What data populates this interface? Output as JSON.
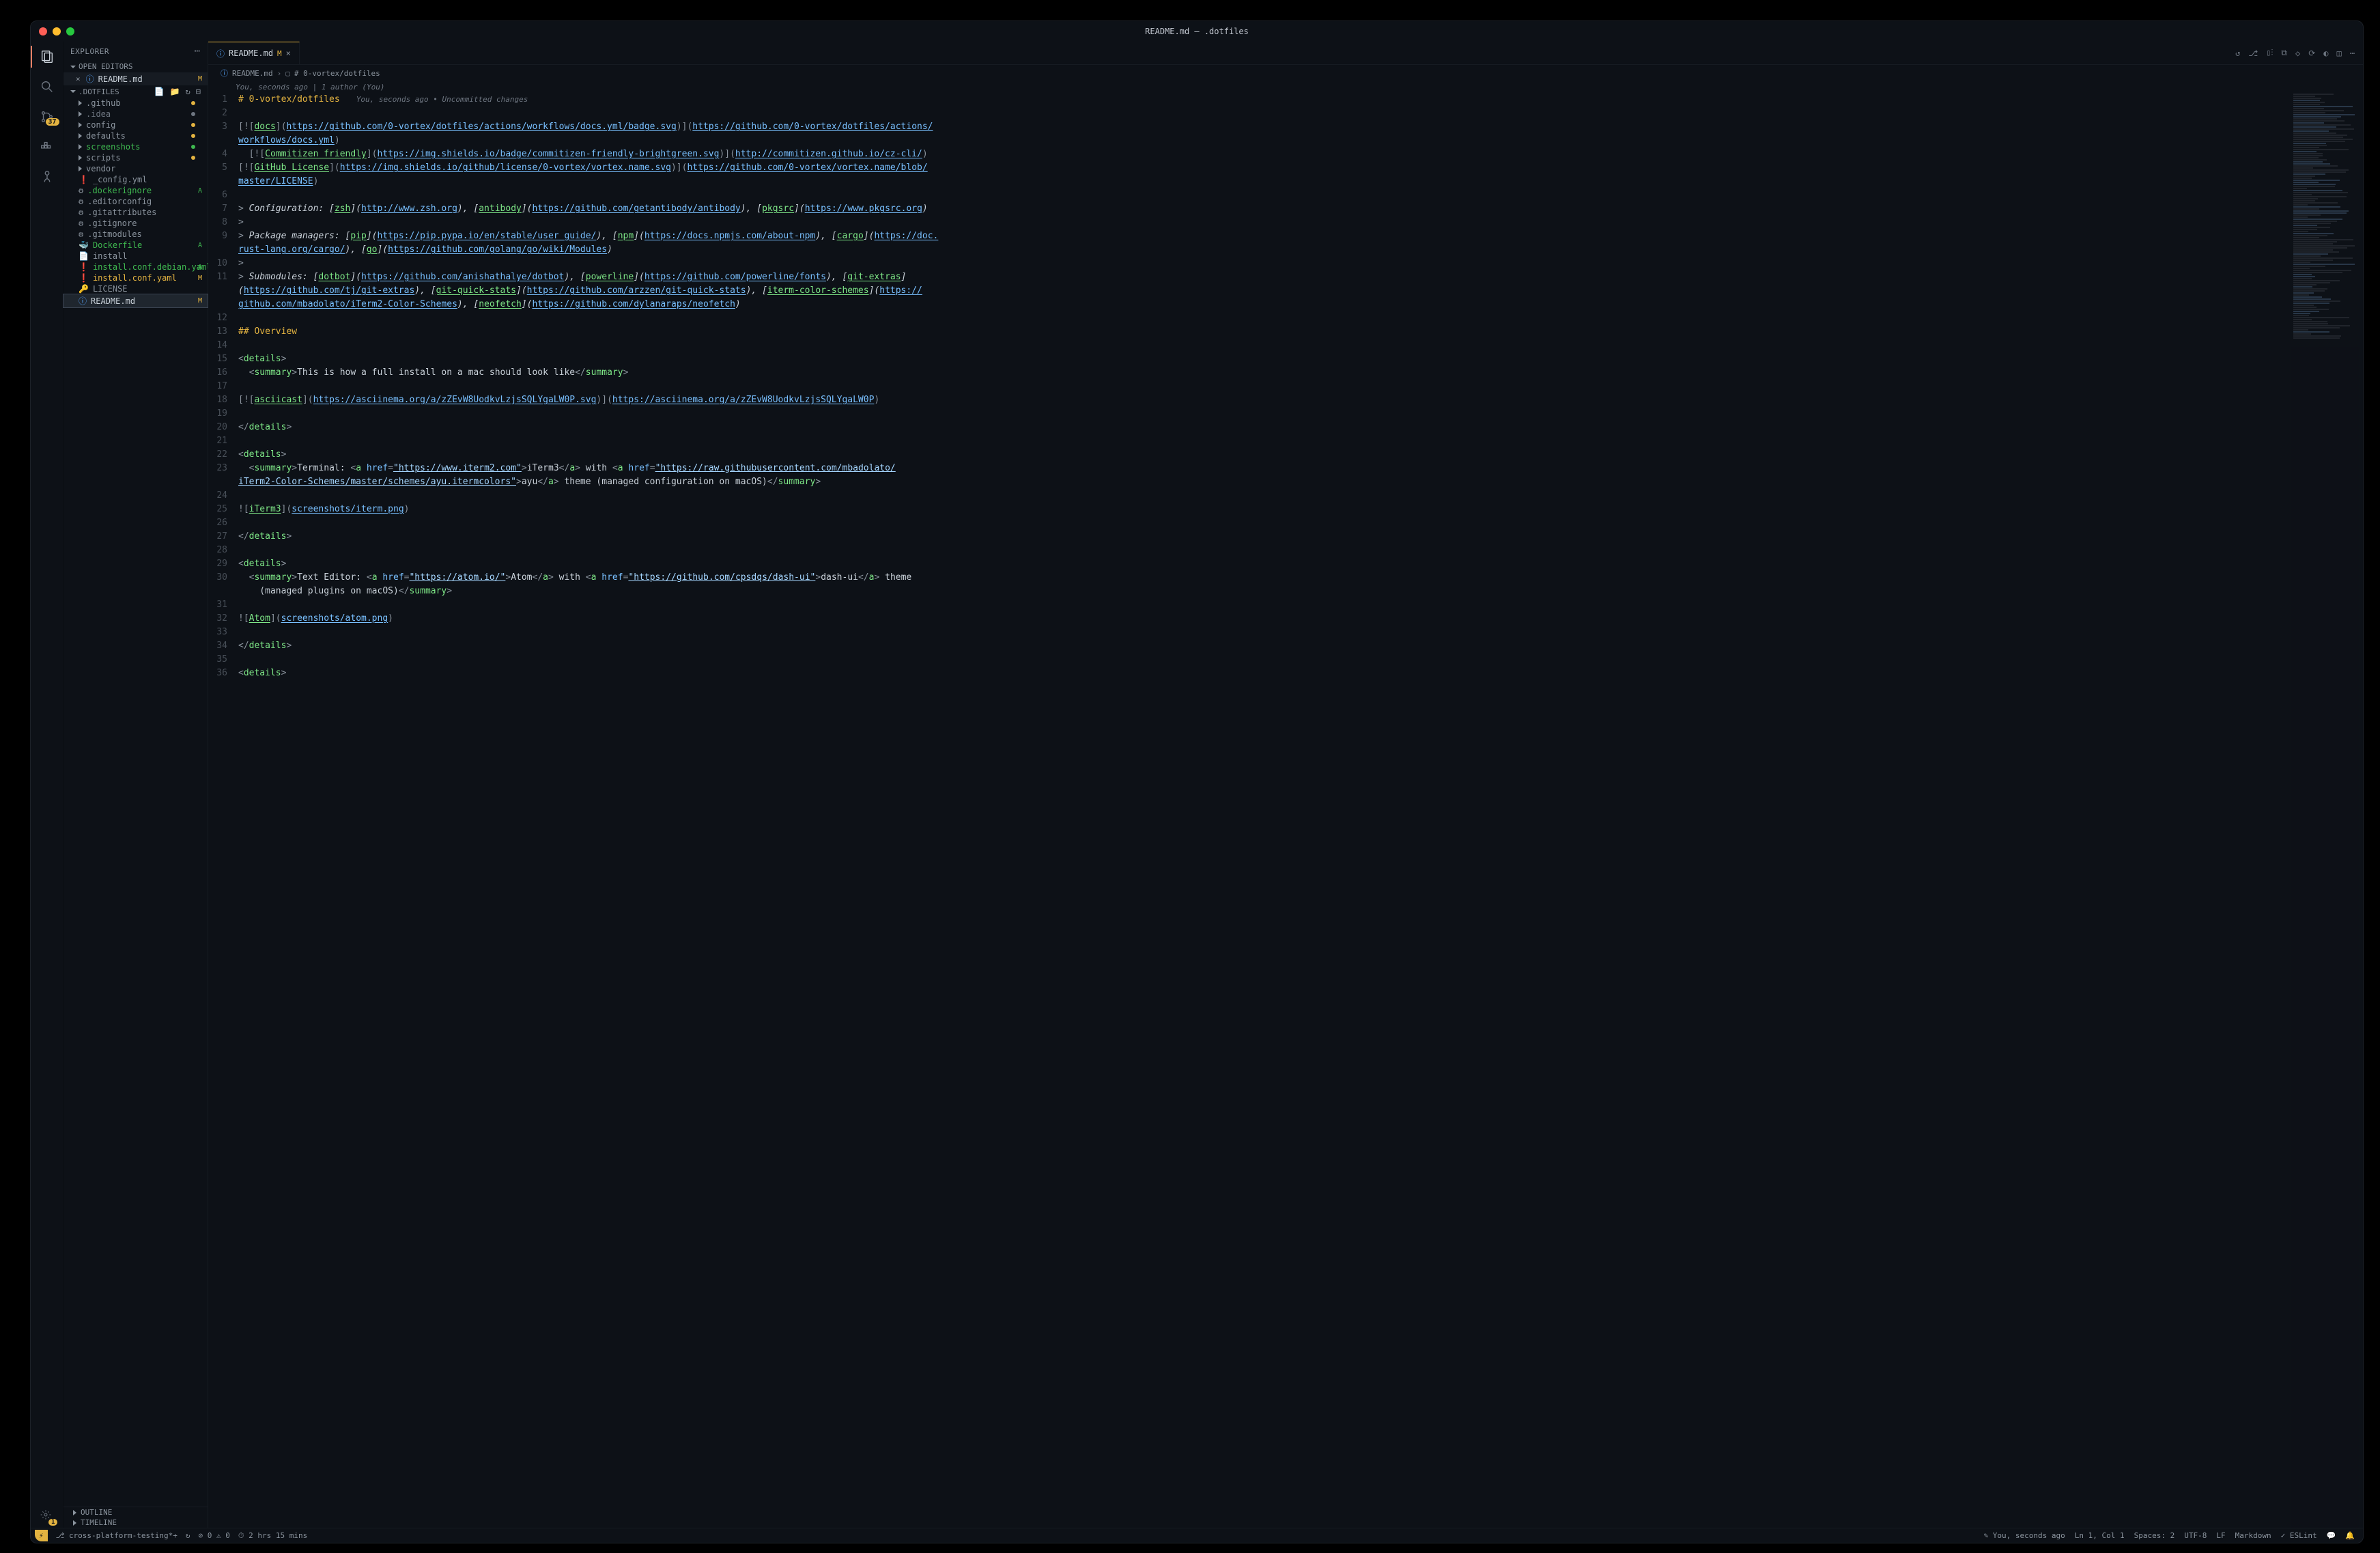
{
  "title": "README.md — .dotfiles",
  "sidebar": {
    "header": "EXPLORER",
    "openEditors": "OPEN EDITORS",
    "workspace": ".DOTFILES",
    "openFile": {
      "name": "README.md",
      "mark": "M"
    },
    "tree": [
      {
        "type": "folder",
        "name": ".github",
        "dot": "y"
      },
      {
        "type": "folder",
        "name": ".idea",
        "dot": "gr",
        "cls": "grey"
      },
      {
        "type": "folder",
        "name": "config",
        "dot": "y"
      },
      {
        "type": "folder",
        "name": "defaults",
        "dot": "y"
      },
      {
        "type": "folder",
        "name": "screenshots",
        "dot": "g",
        "cls": "green"
      },
      {
        "type": "folder",
        "name": "scripts",
        "dot": "y"
      },
      {
        "type": "folder",
        "name": "vendor"
      },
      {
        "type": "file",
        "name": "_config.yml",
        "icon": "excl"
      },
      {
        "type": "file",
        "name": ".dockerignore",
        "icon": "gear",
        "mark": "A",
        "cls": "green"
      },
      {
        "type": "file",
        "name": ".editorconfig",
        "icon": "gear"
      },
      {
        "type": "file",
        "name": ".gitattributes",
        "icon": "gear"
      },
      {
        "type": "file",
        "name": ".gitignore",
        "icon": "gear"
      },
      {
        "type": "file",
        "name": ".gitmodules",
        "icon": "gear"
      },
      {
        "type": "file",
        "name": "Dockerfile",
        "icon": "docker",
        "mark": "A",
        "cls": "green"
      },
      {
        "type": "file",
        "name": "install",
        "icon": "folder"
      },
      {
        "type": "file",
        "name": "install.conf.debian.yaml",
        "icon": "excl",
        "mark": "A",
        "cls": "green"
      },
      {
        "type": "file",
        "name": "install.conf.yaml",
        "icon": "excl",
        "mark": "M",
        "cls": "yellow"
      },
      {
        "type": "file",
        "name": "LICENSE",
        "icon": "lic"
      },
      {
        "type": "file",
        "name": "README.md",
        "icon": "info",
        "mark": "M",
        "sel": true
      }
    ],
    "outline": "OUTLINE",
    "timeline": "TIMELINE"
  },
  "activity_badge": "37",
  "gear_badge": "1",
  "tab": {
    "name": "README.md",
    "mark": "M"
  },
  "crumb": {
    "file": "README.md",
    "symbol": "# 0-vortex/dotfiles"
  },
  "blame": "You, seconds ago | 1 author (You)",
  "blame_inline": "You, seconds ago • Uncommitted changes",
  "status": {
    "branch": "cross-platform-testing*+",
    "sync": "↻",
    "errors": "0",
    "warns": "0",
    "time": "2 hrs 15 mins",
    "gitblame": "You, seconds ago",
    "pos": "Ln 1, Col 1",
    "spaces": "Spaces: 2",
    "enc": "UTF-8",
    "eol": "LF",
    "lang": "Markdown",
    "eslint": "ESLint"
  },
  "code": {
    "h1": "# 0-vortex/dotfiles",
    "l3a": "[![",
    "l3b": "docs",
    "l3c": "](",
    "l3d": "https://github.com/0-vortex/dotfiles/actions/workflows/docs.yml/badge.svg",
    "l3e": ")](",
    "l3f": "https://github.com/0-vortex/dotfiles/actions/",
    "l3g": "workflows/docs.yml",
    "l3h": ")",
    "l4a": "  [![",
    "l4b": "Commitizen friendly",
    "l4c": "](",
    "l4d": "https://img.shields.io/badge/commitizen-friendly-brightgreen.svg",
    "l4e": ")](",
    "l4f": "http://commitizen.github.io/cz-cli/",
    "l4g": ")",
    "l5a": "[![",
    "l5b": "GitHub License",
    "l5c": "](",
    "l5d": "https://img.shields.io/github/license/0-vortex/vortex.name.svg",
    "l5e": ")](",
    "l5f": "https://github.com/0-vortex/vortex.name/blob/",
    "l5g": "master/LICENSE",
    "l5h": ")",
    "l7a": "> ",
    "l7b": "Configuration: [",
    "l7c": "zsh",
    "l7d": "](",
    "l7e": "http://www.zsh.org",
    "l7f": "), [",
    "l7g": "antibody",
    "l7h": "](",
    "l7i": "https://github.com/getantibody/antibody",
    "l7j": "), [",
    "l7k": "pkgsrc",
    "l7l": "](",
    "l7m": "https://www.pkgsrc.org",
    "l7n": ")",
    "l8": ">",
    "l9a": "> ",
    "l9b": "Package managers: [",
    "l9c": "pip",
    "l9d": "](",
    "l9e": "https://pip.pypa.io/en/stable/user_guide/",
    "l9f": "), [",
    "l9g": "npm",
    "l9h": "](",
    "l9i": "https://docs.npmjs.com/about-npm",
    "l9j": "), [",
    "l9k": "cargo",
    "l9l": "](",
    "l9m": "https://doc.",
    "l9n": "rust-lang.org/cargo/",
    "l9o": "), [",
    "l9p": "go",
    "l9q": "](",
    "l9r": "https://github.com/golang/go/wiki/Modules",
    "l9s": ")",
    "l10": ">",
    "l11a": "> ",
    "l11b": "Submodules: [",
    "l11c": "dotbot",
    "l11d": "](",
    "l11e": "https://github.com/anishathalye/dotbot",
    "l11f": "), [",
    "l11g": "powerline",
    "l11h": "](",
    "l11i": "https://github.com/powerline/fonts",
    "l11j": "), [",
    "l11k": "git-extras",
    "l11l": "]",
    "l11m": "(",
    "l11n": "https://github.com/tj/git-extras",
    "l11o": "), [",
    "l11p": "git-quick-stats",
    "l11q": "](",
    "l11r": "https://github.com/arzzen/git-quick-stats",
    "l11s": "), [",
    "l11t": "iterm-color-schemes",
    "l11u": "](",
    "l11v": "https://",
    "l11w": "github.com/mbadolato/iTerm2-Color-Schemes",
    "l11x": "), [",
    "l11y": "neofetch",
    "l11z": "](",
    "l11aa": "https://github.com/dylanaraps/neofetch",
    "l11ab": ")",
    "l13": "## Overview",
    "l15": "<details>",
    "l16a": "  <summary>",
    "l16b": "This is how a full install on a mac should look like",
    "l16c": "</summary>",
    "l18a": "[![",
    "l18b": "asciicast",
    "l18c": "](",
    "l18d": "https://asciinema.org/a/zZEvW8UodkvLzjsSQLYgaLW0P.svg",
    "l18e": ")](",
    "l18f": "https://asciinema.org/a/zZEvW8UodkvLzjsSQLYgaLW0P",
    "l18g": ")",
    "l20": "</details>",
    "l22": "<details>",
    "l23a": "  <summary>",
    "l23b": "Terminal: ",
    "l23c": "<a ",
    "l23d": "href=",
    "l23e": "\"https://www.iterm2.com\"",
    "l23f": ">",
    "l23g": "iTerm3",
    "l23h": "</a>",
    "l23i": " with ",
    "l23j": "<a ",
    "l23k": "href=",
    "l23l": "\"https://raw.githubusercontent.com/mbadolato/",
    "l23m": "iTerm2-Color-Schemes/master/schemes/ayu.itermcolors\"",
    "l23n": ">",
    "l23o": "ayu",
    "l23p": "</a>",
    "l23q": " theme (managed configuration on macOS)",
    "l23r": "</summary>",
    "l25a": "![",
    "l25b": "iTerm3",
    "l25c": "](",
    "l25d": "screenshots/iterm.png",
    "l25e": ")",
    "l27": "</details>",
    "l29": "<details>",
    "l30a": "  <summary>",
    "l30b": "Text Editor: ",
    "l30c": "<a ",
    "l30d": "href=",
    "l30e": "\"https://atom.io/\"",
    "l30f": ">",
    "l30g": "Atom",
    "l30h": "</a>",
    "l30i": " with ",
    "l30j": "<a ",
    "l30k": "href=",
    "l30l": "\"https://github.com/cpsdqs/dash-ui\"",
    "l30m": ">",
    "l30n": "dash-ui",
    "l30o": "</a>",
    "l30p": " theme",
    "l30q": "    (managed plugins on macOS)",
    "l30r": "</summary>",
    "l32a": "![",
    "l32b": "Atom",
    "l32c": "](",
    "l32d": "screenshots/atom.png",
    "l32e": ")",
    "l34": "</details>",
    "l36": "<details>"
  }
}
